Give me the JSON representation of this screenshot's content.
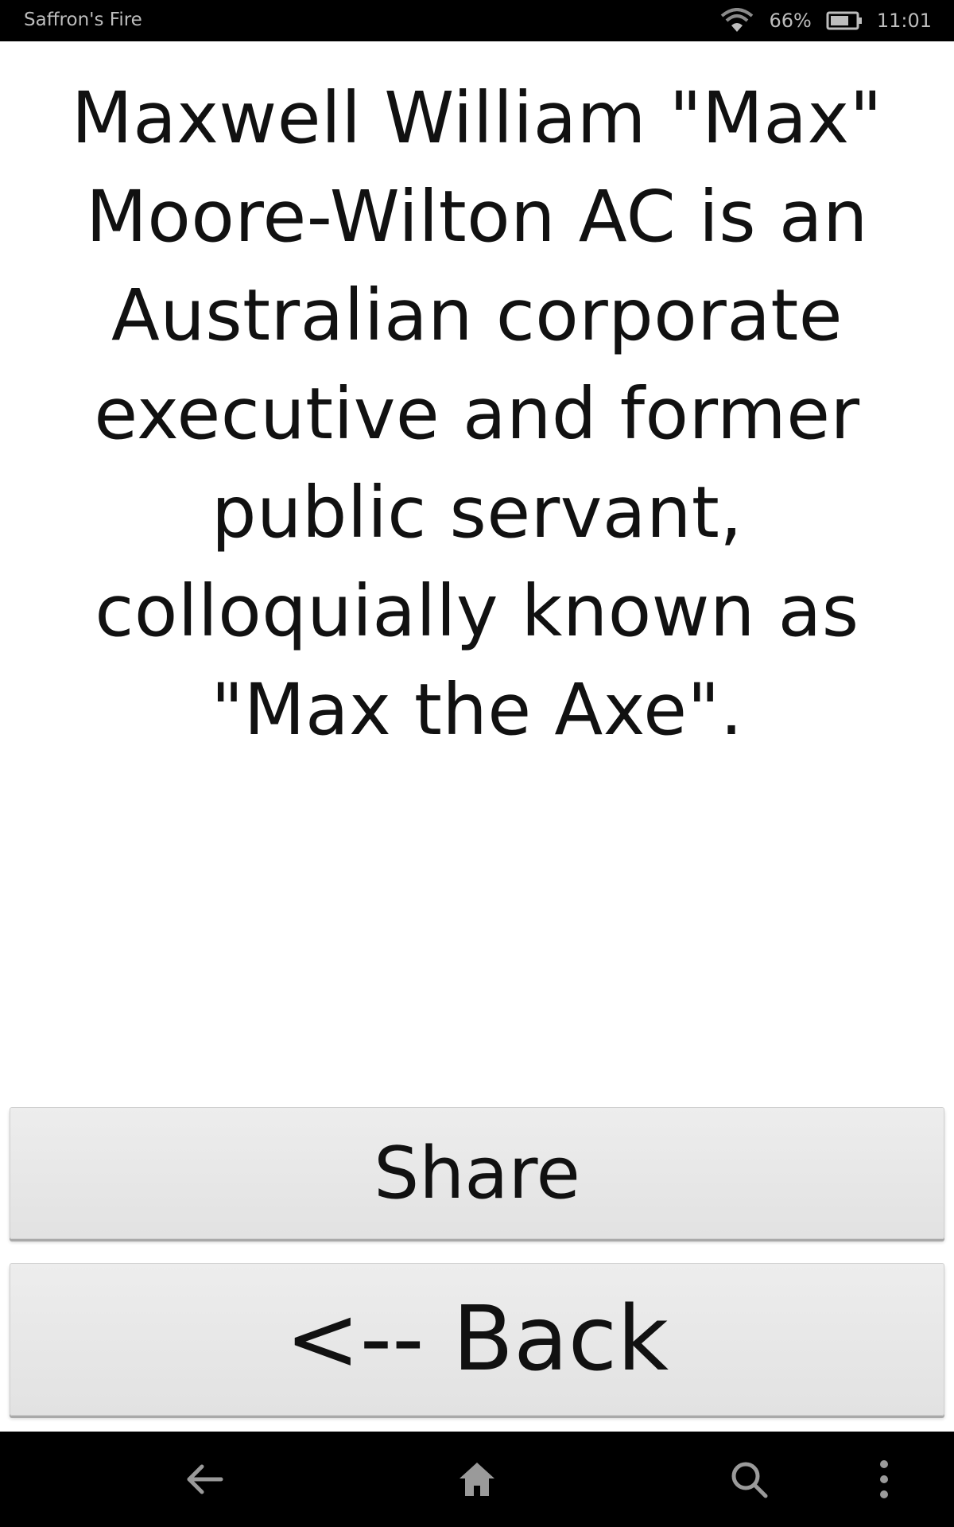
{
  "status_bar": {
    "app_name": "Saffron's Fire",
    "battery_percent": "66%",
    "time": "11:01",
    "icons": [
      "wifi-icon",
      "battery-icon"
    ]
  },
  "content": {
    "text": "Maxwell William \"Max\" Moore-Wilton AC  is an Australian corporate executive and former public servant, colloquially known as \"Max the Axe\"."
  },
  "buttons": {
    "share_label": "Share",
    "back_label": "<-- Back"
  },
  "nav_bar": {
    "icons": [
      "back-arrow-icon",
      "home-icon",
      "search-icon",
      "more-vert-icon"
    ]
  },
  "colors": {
    "status_bar_bg": "#000000",
    "button_bg": "#e6e6e6",
    "text": "#111111"
  }
}
